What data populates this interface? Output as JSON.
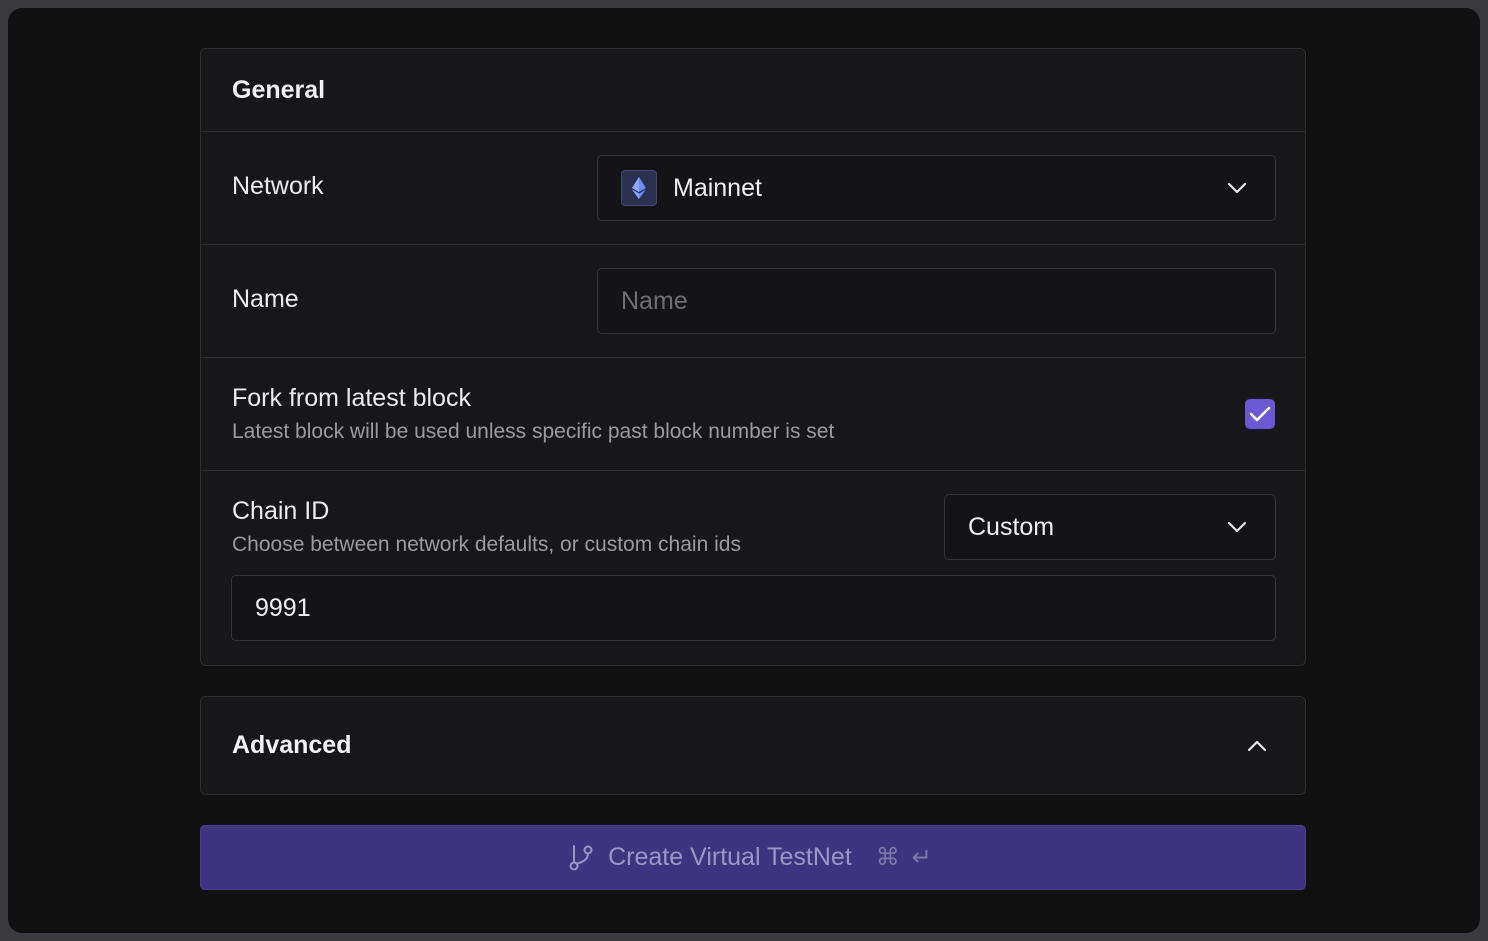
{
  "general": {
    "title": "General",
    "network": {
      "label": "Network",
      "selected": "Mainnet",
      "icon": "ethereum-icon"
    },
    "name": {
      "label": "Name",
      "placeholder": "Name",
      "value": ""
    },
    "fork": {
      "label": "Fork from latest block",
      "description": "Latest block will be used unless specific past block number is set",
      "checked": true
    },
    "chain_id": {
      "label": "Chain ID",
      "description": "Choose between network defaults, or custom chain ids",
      "mode": "Custom",
      "value": "9991"
    }
  },
  "advanced": {
    "title": "Advanced",
    "expanded": true
  },
  "create_button": {
    "label": "Create Virtual TestNet",
    "shortcut_cmd": "⌘",
    "shortcut_enter": "↵"
  },
  "colors": {
    "background": "#111112",
    "card": "#17171a",
    "accent": "#6b59d3",
    "button": "#3e3480"
  }
}
